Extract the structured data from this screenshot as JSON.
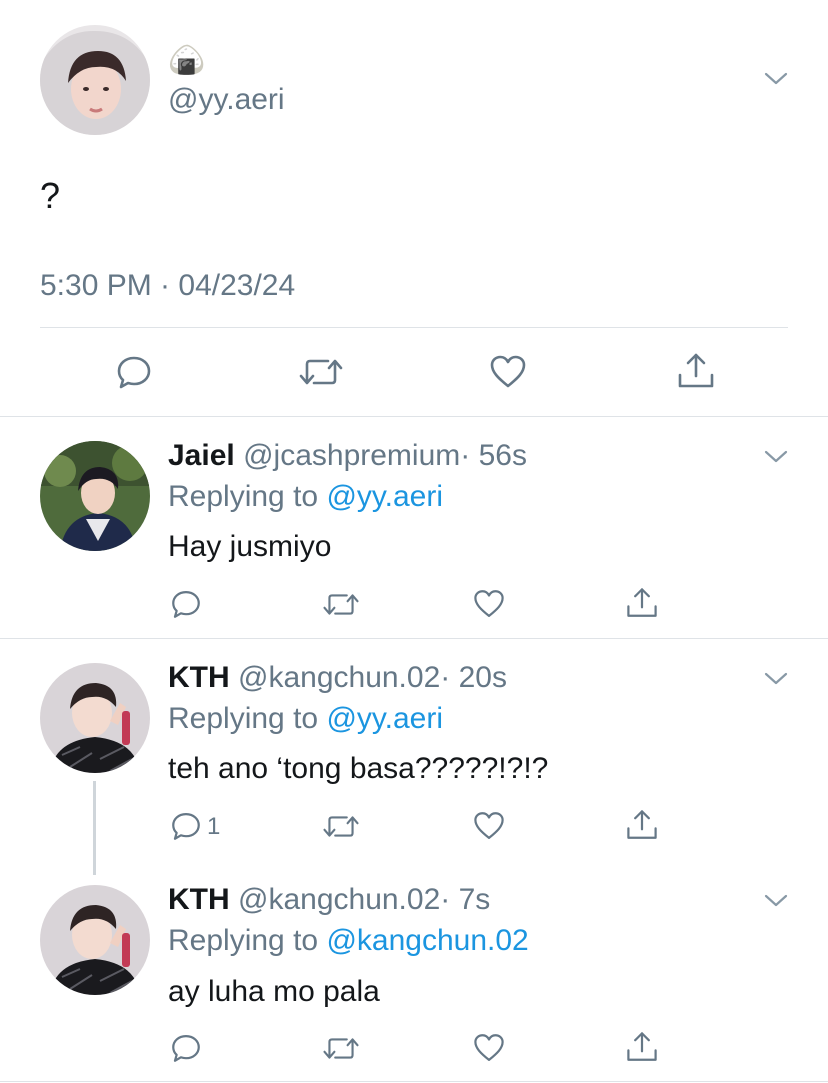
{
  "main_tweet": {
    "display_name_emoji": "🍙",
    "handle": "@yy.aeri",
    "text": "?",
    "timestamp": "5:30 PM · 04/23/24",
    "actions": [
      "reply-icon",
      "retweet-icon",
      "like-icon",
      "share-icon"
    ]
  },
  "replies": [
    {
      "name": "Jaiel",
      "handle": "@jcashpremium",
      "time": "· 56s",
      "replying_prefix": "Replying to",
      "replying_to": "@yy.aeri",
      "text": "Hay jusmiyo",
      "reply_count": ""
    },
    {
      "name": "KTH",
      "handle": "@kangchun.02",
      "time": "· 20s",
      "replying_prefix": "Replying to",
      "replying_to": "@yy.aeri",
      "text": "teh ano ‘tong basa?????!?!?",
      "reply_count": "1"
    },
    {
      "name": "KTH",
      "handle": "@kangchun.02",
      "time": "· 7s",
      "replying_prefix": "Replying to",
      "replying_to": "@kangchun.02",
      "text": "ay luha mo pala",
      "reply_count": ""
    }
  ],
  "colors": {
    "text": "#14171a",
    "muted": "#657786",
    "link": "#1b95e0",
    "divider": "#dfe3e7"
  }
}
